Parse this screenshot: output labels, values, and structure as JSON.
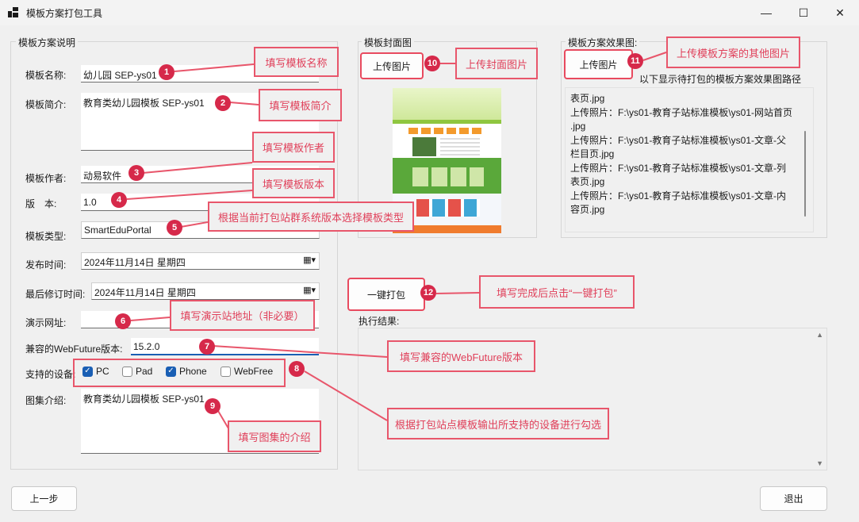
{
  "window": {
    "title": "模板方案打包工具",
    "minimize": "—",
    "maximize": "☐",
    "close": "✕"
  },
  "left_group": {
    "title": "模板方案说明",
    "name_label": "模板名称:",
    "name_value": "幼儿园 SEP-ys01",
    "intro_label": "模板简介:",
    "intro_value": "教育类幼儿园模板 SEP-ys01",
    "author_label": "模板作者:",
    "author_value": "动易软件",
    "version_label": "版　本:",
    "version_value": "1.0",
    "type_label": "模板类型:",
    "type_value": "SmartEduPortal",
    "publish_label": "发布时间:",
    "publish_value": "2024年11月14日  星期四",
    "revise_label": "最后修订时间:",
    "revise_value": "2024年11月14日  星期四",
    "demo_label": "演示网址:",
    "demo_value": "",
    "wf_label": "兼容的WebFuture版本:",
    "wf_value": "15.2.0",
    "devices_label": "支持的设备:",
    "devices": [
      {
        "label": "PC",
        "checked": true
      },
      {
        "label": "Pad",
        "checked": false
      },
      {
        "label": "Phone",
        "checked": true
      },
      {
        "label": "WebFree",
        "checked": false
      }
    ],
    "gallery_label": "图集介绍:",
    "gallery_value": "教育类幼儿园模板 SEP-ys01"
  },
  "cover_group": {
    "title": "模板封面图",
    "upload_label": "上传图片"
  },
  "effects_group": {
    "title": "模板方案效果图:",
    "upload_label": "上传图片",
    "hint": "以下显示待打包的模板方案效果图路径",
    "lines": [
      "表页.jpg",
      "上传照片：F:\\ys01-教育子站标准模板\\ys01-网站首页",
      ".jpg",
      "上传照片：F:\\ys01-教育子站标准模板\\ys01-文章-父",
      "栏目页.jpg",
      "上传照片：F:\\ys01-教育子站标准模板\\ys01-文章-列",
      "表页.jpg",
      "上传照片：F:\\ys01-教育子站标准模板\\ys01-文章-内",
      "容页.jpg"
    ]
  },
  "pack_button": "一键打包",
  "result_label": "执行结果:",
  "prev_button": "上一步",
  "exit_button": "退出",
  "annotations": [
    {
      "num": "1",
      "text": "填写模板名称"
    },
    {
      "num": "2",
      "text": "填写模板简介"
    },
    {
      "num": "3",
      "text": "填写模板作者"
    },
    {
      "num": "4",
      "text": "填写模板版本"
    },
    {
      "num": "5",
      "text": "根据当前打包站群系统版本选择模板类型"
    },
    {
      "num": "6",
      "text": "填写演示站地址（非必要）"
    },
    {
      "num": "7",
      "text": "填写兼容的WebFuture版本"
    },
    {
      "num": "8",
      "text": "根据打包站点模板输出所支持的设备进行勾选"
    },
    {
      "num": "9",
      "text": "填写图集的介绍"
    },
    {
      "num": "10",
      "text": "上传封面图片"
    },
    {
      "num": "11",
      "text": "上传模板方案的其他图片"
    },
    {
      "num": "12",
      "text": "填写完成后点击“一键打包”"
    }
  ],
  "colors": {
    "annotation": "#e8566b",
    "badge": "#d6294a",
    "checkbox": "#1a5fb4",
    "window_bg": "#f0f0f0"
  }
}
